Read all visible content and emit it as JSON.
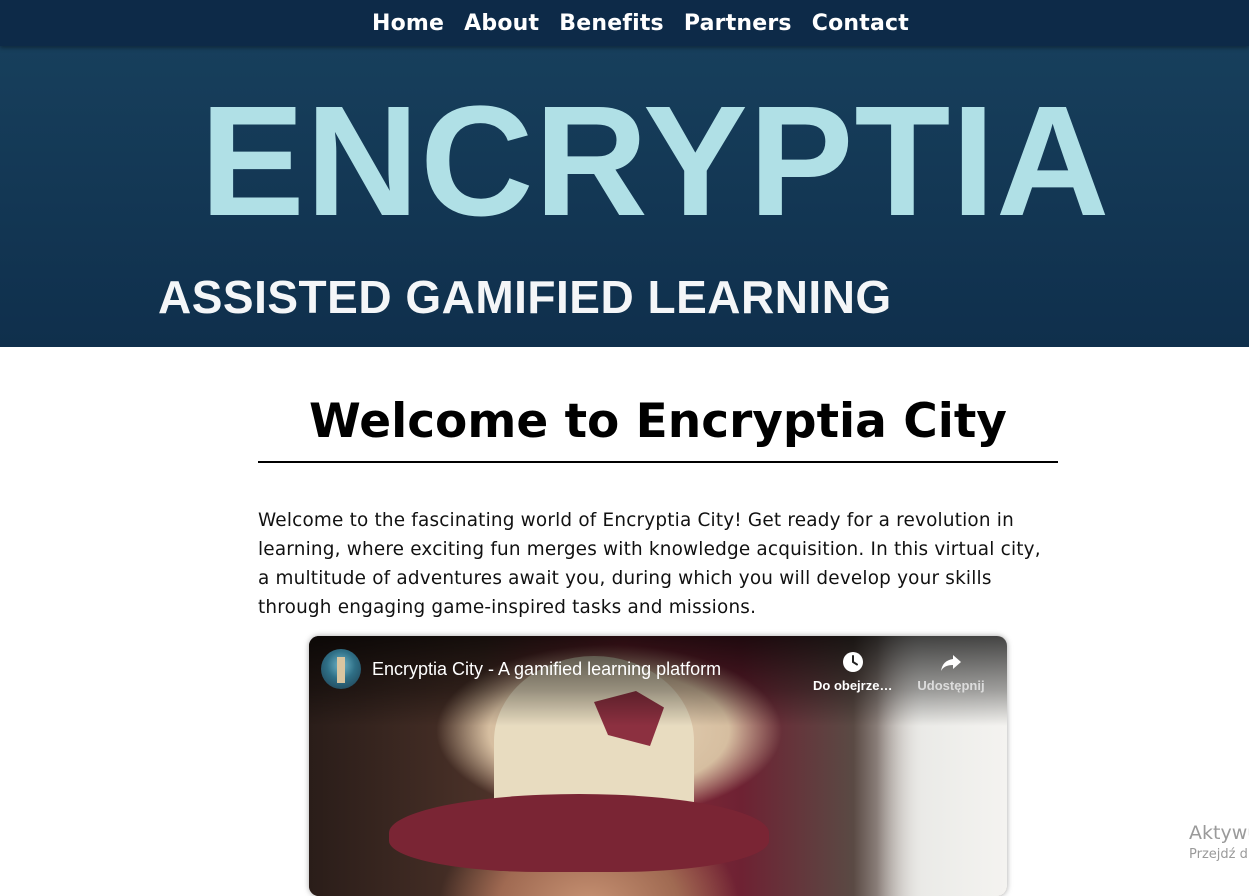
{
  "nav": {
    "links": [
      "Home",
      "About",
      "Benefits",
      "Partners",
      "Contact"
    ]
  },
  "hero": {
    "title": "ENCRYPTIA",
    "subtitle": "ASSISTED GAMIFIED LEARNING"
  },
  "main": {
    "title": "Welcome to Encryptia City",
    "intro": "Welcome to the fascinating world of Encryptia City! Get ready for a revolution in learning, where exciting fun merges with knowledge acquisition. In this virtual city, a multitude of adventures await you, during which you will develop your skills through engaging game-inspired tasks and missions."
  },
  "video": {
    "title": "Encryptia City - A gamified learning platform",
    "watch_later_label": "Do obejrzenia",
    "share_label": "Udostępnij",
    "icons": {
      "watch_later": "clock-icon",
      "share": "share-arrow-icon",
      "channel": "channel-avatar"
    }
  },
  "system_overlay": {
    "title": "Aktywuj",
    "subtitle": "Przejdź d"
  },
  "colors": {
    "nav_bg": "#0d2a48",
    "hero_bg": "#133752",
    "hero_title": "#b0e0e6",
    "hero_subtitle": "#f4f6f8",
    "text": "#000000"
  }
}
